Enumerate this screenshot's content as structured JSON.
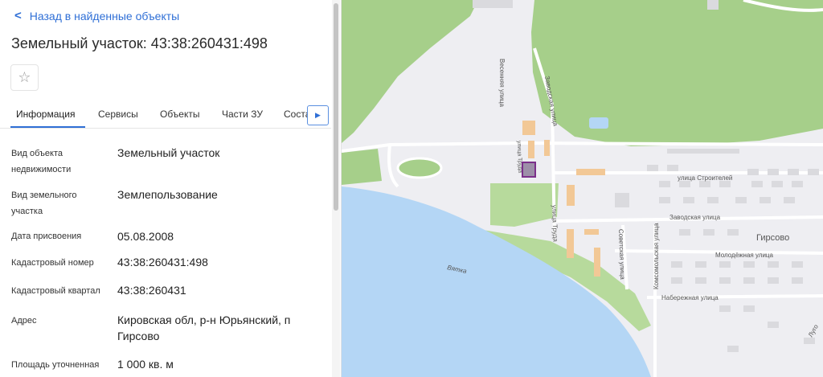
{
  "panel": {
    "back_label": "Назад в найденные объекты",
    "title": "Земельный участок: 43:38:260431:498",
    "star_icon": "star-outline-icon",
    "tabs": [
      {
        "label": "Информация",
        "active": true
      },
      {
        "label": "Сервисы"
      },
      {
        "label": "Объекты"
      },
      {
        "label": "Части ЗУ"
      },
      {
        "label": "Состав"
      }
    ],
    "properties": [
      {
        "label": "Вид объекта недвижимости",
        "value": "Земельный участок"
      },
      {
        "label": "Вид земельного участка",
        "value": "Землепользование"
      },
      {
        "label": "Дата присвоения",
        "value": "05.08.2008"
      },
      {
        "label": "Кадастровый номер",
        "value": "43:38:260431:498"
      },
      {
        "label": "Кадастровый квартал",
        "value": "43:38:260431"
      },
      {
        "label": "Адрес",
        "value": "Кировская обл, р-н Юрьянский, п Гирсово"
      },
      {
        "label": "Площадь уточненная",
        "value": "1 000 кв. м"
      }
    ]
  },
  "map": {
    "river": "Вятка",
    "settlement": "Гирсово",
    "streets": [
      "Весенняя улица",
      "Заводская улица",
      "улица Труда",
      "улица Строителей",
      "Заводская улица",
      "Советская улица",
      "Комсомольская улица",
      "Молодёжная улица",
      "Набережная улица",
      "улица Труда",
      "Луго"
    ],
    "colors": {
      "forest": "#a6cf8a",
      "water": "#b4d6f5",
      "land": "#eeeef2",
      "parcel_highlight": "#7b2f8a"
    }
  }
}
